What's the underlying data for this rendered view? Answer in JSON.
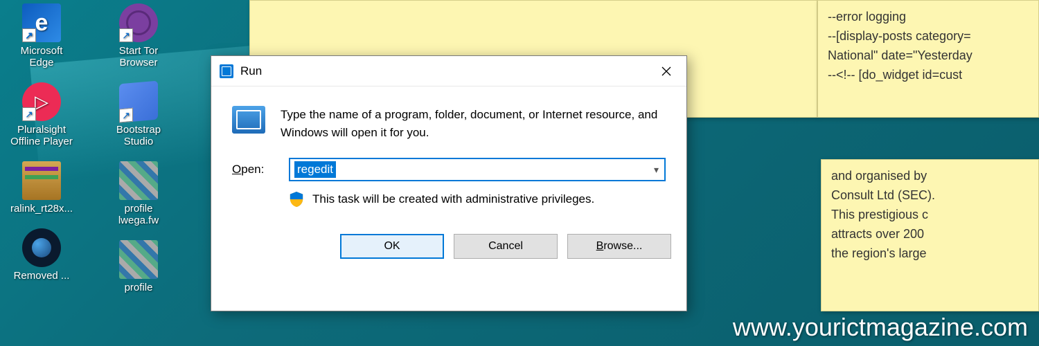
{
  "desktop": {
    "col1": [
      {
        "label": "Microsoft Edge"
      },
      {
        "label": "Pluralsight Offline Player"
      },
      {
        "label": "ralink_rt28x..."
      },
      {
        "label": "Removed ..."
      }
    ],
    "col2": [
      {
        "label": "Start Tor Browser"
      },
      {
        "label": "Bootstrap Studio"
      },
      {
        "label": "profile lwega.fw"
      },
      {
        "label": "profile"
      }
    ]
  },
  "sticky_notes": {
    "note2": {
      "line1": "--error logging",
      "line2": "--[display-posts category=",
      "line3": "National\" date=\"Yesterday",
      "line4": "--<!-- [do_widget id=cust"
    },
    "note3": {
      "line1": "and organised by",
      "line2": "Consult Ltd (SEC).",
      "line3": "This prestigious c",
      "line4": "attracts over 200",
      "line5": "the region's large"
    }
  },
  "run_dialog": {
    "title": "Run",
    "description": "Type the name of a program, folder, document, or Internet resource, and Windows will open it for you.",
    "open_label_prefix": "O",
    "open_label_rest": "pen:",
    "input_value": "regedit",
    "admin_note": "This task will be created with administrative privileges.",
    "buttons": {
      "ok": "OK",
      "cancel": "Cancel",
      "browse_prefix": "B",
      "browse_rest": "rowse..."
    }
  },
  "watermark": "www.yourictmagazine.com"
}
